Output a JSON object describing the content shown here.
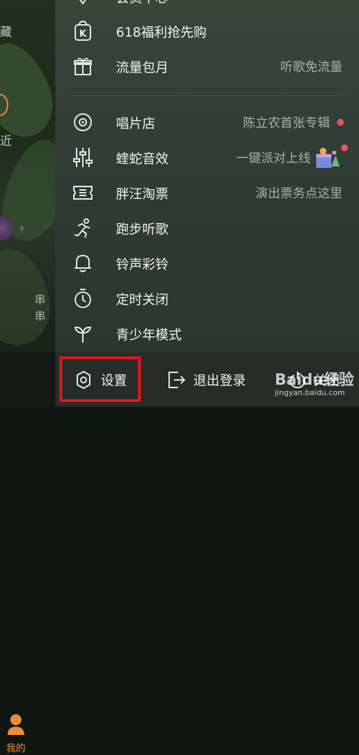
{
  "background_app": {
    "side_texts": [
      "藏",
      "近",
      "串串"
    ],
    "bottom_nav_label": "我的",
    "accent_color": "#f08a3b"
  },
  "drawer": {
    "top_partial_label": "会员中心",
    "items": [
      {
        "label": "618福利抢先购",
        "right": "",
        "icon": "k-bag-icon"
      },
      {
        "label": "流量包月",
        "right": "听歌免流量",
        "icon": "gift-box-icon"
      },
      {
        "label": "唱片店",
        "right": "陈立农首张专辑",
        "icon": "vinyl-disc-icon",
        "badge": true
      },
      {
        "label": "蝰蛇音效",
        "right": "一键派对上线",
        "icon": "equalizer-icon",
        "badge": true
      },
      {
        "label": "胖汪淘票",
        "right": "演出票务点这里",
        "icon": "ticket-icon"
      },
      {
        "label": "跑步听歌",
        "right": "",
        "icon": "running-icon"
      },
      {
        "label": "铃声彩铃",
        "right": "",
        "icon": "bell-icon"
      },
      {
        "label": "定时关闭",
        "right": "",
        "icon": "timer-icon"
      },
      {
        "label": "青少年模式",
        "right": "",
        "icon": "sprout-icon"
      }
    ],
    "badge_color": "#f0505a"
  },
  "bottom_bar": {
    "settings_label": "设置",
    "logout_label": "退出登录",
    "close_label": "关闭",
    "highlight_color": "#e8141c"
  },
  "watermark": {
    "logo": "Baidu经验",
    "url": "jingyan.baidu.com"
  }
}
